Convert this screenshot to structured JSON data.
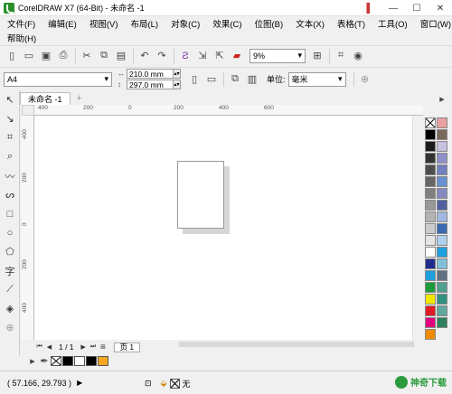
{
  "window": {
    "title": "CorelDRAW X7 (64-Bit) - 未命名 -1"
  },
  "menus": {
    "row1": [
      "文件(F)",
      "编辑(E)",
      "视图(V)",
      "布局(L)",
      "对象(C)",
      "效果(C)",
      "位图(B)",
      "文本(X)",
      "表格(T)",
      "工具(O)",
      "窗口(W)"
    ],
    "row2": [
      "帮助(H)"
    ]
  },
  "toolbar": {
    "zoom": "9%"
  },
  "property_bar": {
    "page_size": "A4",
    "width": "210.0 mm",
    "height": "297.0 mm",
    "unit_label": "单位:",
    "unit": "毫米"
  },
  "document": {
    "tab": "未命名 -1"
  },
  "rulers": {
    "h_ticks": [
      "400",
      "200",
      "0",
      "200",
      "400",
      "600"
    ],
    "v_ticks": [
      "400",
      "200",
      "0",
      "200",
      "400"
    ]
  },
  "page_nav": {
    "counter": "1 / 1",
    "page_tab": "页 1"
  },
  "palette": {
    "left": [
      "#000000",
      "#1a1a1a",
      "#333333",
      "#4d4d4d",
      "#666666",
      "#808080",
      "#999999",
      "#b3b3b3",
      "#cccccc",
      "#e6e6e6",
      "#ffffff",
      "#1f2d8c",
      "#1ea0e0",
      "#1b9c3a",
      "#f2e600",
      "#e01b24",
      "#e4007f",
      "#f08a00"
    ],
    "right": [
      "#e8a0a0",
      "#7a6a5a",
      "#c8c0e0",
      "#9090c8",
      "#7080c0",
      "#6890d0",
      "#8888c0",
      "#5060a0",
      "#a0b8e0",
      "#3a6ab0",
      "#b0d0f0",
      "#1ea0e0",
      "#80c0d8",
      "#607080",
      "#50a090",
      "#309080",
      "#60a8a0",
      "#308060"
    ]
  },
  "recent_colors": [
    "#000000",
    "#ffffff",
    "#000000",
    "#f5a623"
  ],
  "status": {
    "coords": "( 57.166, 29.793 )",
    "fill_label": "无"
  },
  "watermark": {
    "text": "神奇下载"
  }
}
